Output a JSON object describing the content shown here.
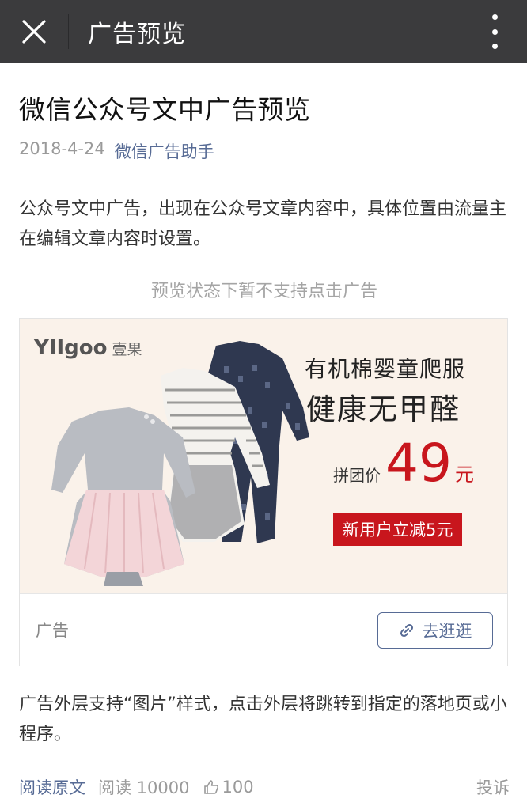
{
  "topbar": {
    "close_icon": "close-icon",
    "title": "广告预览",
    "more_icon": "more-vertical-icon"
  },
  "article": {
    "title": "微信公众号文中广告预览",
    "date": "2018-4-24",
    "author": "微信广告助手",
    "paragraph1": "公众号文中广告，出现在公众号文章内容中，具体位置由流量主在编辑文章内容时设置。",
    "divider_text": "预览状态下暂不支持点击广告",
    "paragraph2": "广告外层支持“图片”样式，点击外层将跳转到指定的落地页或小程序。"
  },
  "ad": {
    "brand_logo": "YIIgoo",
    "brand_cn": "壹果",
    "headline1": "有机棉婴童爬服",
    "headline2": "健康无甲醛",
    "price_label": "拼团价",
    "price_value": "49",
    "price_unit": "元",
    "promo": "新用户立减5元",
    "label": "广告",
    "cta_label": "去逛逛",
    "cta_icon": "link-icon",
    "colors": {
      "accent_red": "#c8161d",
      "link_blue": "#576b95",
      "image_bg": "#faf2ea"
    }
  },
  "footer": {
    "read_original": "阅读原文",
    "read_count": "阅读 10000",
    "like_icon": "thumbs-up-icon",
    "like_count": "100",
    "report": "投诉"
  }
}
